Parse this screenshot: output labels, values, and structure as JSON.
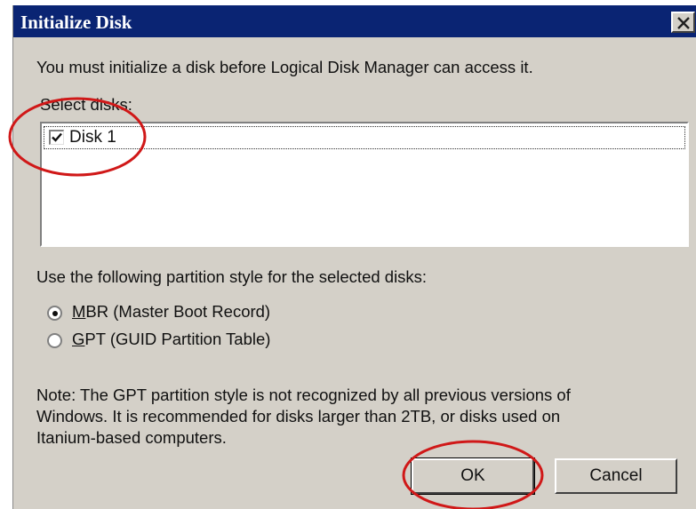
{
  "window": {
    "title": "Initialize Disk",
    "close_glyph": "close-icon"
  },
  "intro_text": "You must initialize a disk before Logical Disk Manager can access it.",
  "select_label": "Select disks:",
  "disks": [
    {
      "label": "Disk 1",
      "checked": true
    }
  ],
  "partition": {
    "label": "Use the following partition style for the selected disks:",
    "options": [
      {
        "accel": "M",
        "rest": "BR (Master Boot Record)",
        "selected": true
      },
      {
        "accel": "G",
        "rest": "PT (GUID Partition Table)",
        "selected": false
      }
    ]
  },
  "note": {
    "line1": "Note: The GPT partition style is not recognized by all previous versions of",
    "line2": "Windows. It is recommended for disks larger than 2TB, or disks used on",
    "line3": "Itanium-based computers."
  },
  "buttons": {
    "ok": "OK",
    "cancel": "Cancel"
  },
  "colors": {
    "titlebar": "#0a2473",
    "dialog_bg": "#d4d0c8",
    "annotation": "#d01818"
  }
}
